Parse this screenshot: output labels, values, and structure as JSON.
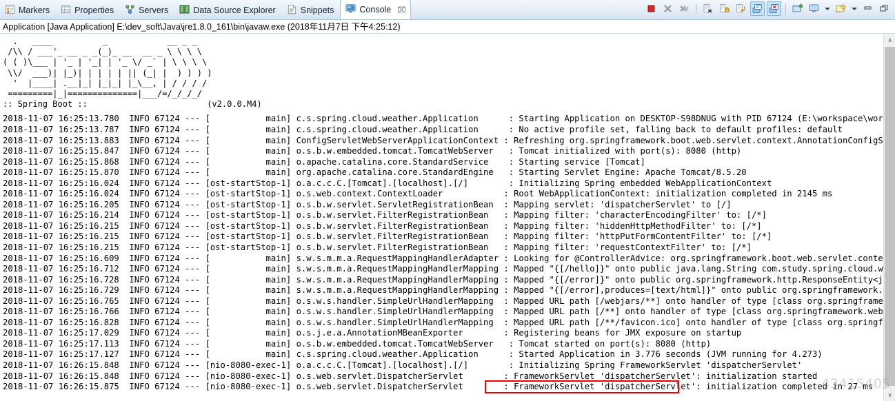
{
  "tabs": [
    {
      "label": "Markers",
      "icon": "markers-icon",
      "active": false
    },
    {
      "label": "Properties",
      "icon": "properties-icon",
      "active": false
    },
    {
      "label": "Servers",
      "icon": "servers-icon",
      "active": false
    },
    {
      "label": "Data Source Explorer",
      "icon": "datasource-icon",
      "active": false
    },
    {
      "label": "Snippets",
      "icon": "snippets-icon",
      "active": false
    },
    {
      "label": "Console",
      "icon": "console-icon",
      "active": true,
      "close_glyph": "⌧"
    }
  ],
  "toolbar": {
    "buttons": [
      {
        "name": "terminate-button",
        "title": "Terminate"
      },
      {
        "name": "remove-launch-button",
        "title": "Remove Launch"
      },
      {
        "name": "remove-all-terminated-button",
        "title": "Remove All Terminated Launches"
      },
      {
        "name": "clear-console-button",
        "title": "Clear Console"
      },
      {
        "name": "scroll-lock-button",
        "title": "Scroll Lock"
      },
      {
        "name": "word-wrap-button",
        "title": "Word Wrap"
      },
      {
        "name": "show-console-stdout-button",
        "title": "Show Console When Standard Out Changes",
        "pressed": true
      },
      {
        "name": "show-console-stderr-button",
        "title": "Show Console When Standard Error Changes",
        "pressed": true
      },
      {
        "name": "pin-console-button",
        "title": "Pin Console"
      },
      {
        "name": "display-selected-console-button",
        "title": "Display Selected Console"
      },
      {
        "name": "open-console-button",
        "title": "Open Console"
      },
      {
        "name": "minimize-button",
        "title": "Minimize"
      },
      {
        "name": "maximize-button",
        "title": "Maximize"
      }
    ]
  },
  "launch_config": {
    "text": "Application [Java Application] E:\\dev_soft\\Java\\jre1.8.0_161\\bin\\javaw.exe (2018年11月7日 下午4:25:12)"
  },
  "banner": {
    "ascii": "  .   ____          _            __ _ _\n /\\\\ / ___'_ __ _ _(_)_ __  __ _ \\ \\ \\ \\\n( ( )\\___ | '_ | '_| | '_ \\/ _` | \\ \\ \\ \\\n \\\\/  ___)| |_)| | | | | || (_| |  ) ) ) )\n  '  |____| .__|_| |_|_| |_\\__, | / / / /\n =========|_|==============|___/=/_/_/_/",
    "name": ":: Spring Boot ::",
    "version": "(v2.0.0.M4)"
  },
  "highlight": {
    "color": "#ee0000",
    "line_index": 25,
    "text": "Tomcat started on port(s): 8080 (http)"
  },
  "watermark": {
    "text": "43415405"
  },
  "scrollbar": {
    "up_glyph": "∧",
    "down_glyph": "∨"
  },
  "log_lines": [
    "2018-11-07 16:25:13.780  INFO 67124 --- [           main] c.s.spring.cloud.weather.Application      : Starting Application on DESKTOP-S98DNUG with PID 67124 (E:\\workspace\\workspace-st",
    "2018-11-07 16:25:13.787  INFO 67124 --- [           main] c.s.spring.cloud.weather.Application      : No active profile set, falling back to default profiles: default",
    "2018-11-07 16:25:13.883  INFO 67124 --- [           main] ConfigServletWebServerApplicationContext : Refreshing org.springframework.boot.web.servlet.context.AnnotationConfigServletWe",
    "2018-11-07 16:25:15.847  INFO 67124 --- [           main] o.s.b.w.embedded.tomcat.TomcatWebServer   : Tomcat initialized with port(s): 8080 (http)",
    "2018-11-07 16:25:15.868  INFO 67124 --- [           main] o.apache.catalina.core.StandardService    : Starting service [Tomcat]",
    "2018-11-07 16:25:15.870  INFO 67124 --- [           main] org.apache.catalina.core.StandardEngine   : Starting Servlet Engine: Apache Tomcat/8.5.20",
    "2018-11-07 16:25:16.024  INFO 67124 --- [ost-startStop-1] o.a.c.c.C.[Tomcat].[localhost].[/]        : Initializing Spring embedded WebApplicationContext",
    "2018-11-07 16:25:16.024  INFO 67124 --- [ost-startStop-1] o.s.web.context.ContextLoader            : Root WebApplicationContext: initialization completed in 2145 ms",
    "2018-11-07 16:25:16.205  INFO 67124 --- [ost-startStop-1] o.s.b.w.servlet.ServletRegistrationBean  : Mapping servlet: 'dispatcherServlet' to [/]",
    "2018-11-07 16:25:16.214  INFO 67124 --- [ost-startStop-1] o.s.b.w.servlet.FilterRegistrationBean   : Mapping filter: 'characterEncodingFilter' to: [/*]",
    "2018-11-07 16:25:16.215  INFO 67124 --- [ost-startStop-1] o.s.b.w.servlet.FilterRegistrationBean   : Mapping filter: 'hiddenHttpMethodFilter' to: [/*]",
    "2018-11-07 16:25:16.215  INFO 67124 --- [ost-startStop-1] o.s.b.w.servlet.FilterRegistrationBean   : Mapping filter: 'httpPutFormContentFilter' to: [/*]",
    "2018-11-07 16:25:16.215  INFO 67124 --- [ost-startStop-1] o.s.b.w.servlet.FilterRegistrationBean   : Mapping filter: 'requestContextFilter' to: [/*]",
    "2018-11-07 16:25:16.609  INFO 67124 --- [           main] s.w.s.m.m.a.RequestMappingHandlerAdapter : Looking for @ControllerAdvice: org.springframework.boot.web.servlet.context.Annot",
    "2018-11-07 16:25:16.712  INFO 67124 --- [           main] s.w.s.m.m.a.RequestMappingHandlerMapping : Mapped \"{[/hello]}\" onto public java.lang.String com.study.spring.cloud.weather.c",
    "2018-11-07 16:25:16.728  INFO 67124 --- [           main] s.w.s.m.m.a.RequestMappingHandlerMapping : Mapped \"{[/error]}\" onto public org.springframework.http.ResponseEntity<java.util",
    "2018-11-07 16:25:16.729  INFO 67124 --- [           main] s.w.s.m.m.a.RequestMappingHandlerMapping : Mapped \"{[/error],produces=[text/html]}\" onto public org.springframework.web.serv",
    "2018-11-07 16:25:16.765  INFO 67124 --- [           main] o.s.w.s.handler.SimpleUrlHandlerMapping  : Mapped URL path [/webjars/**] onto handler of type [class org.springframework.web",
    "2018-11-07 16:25:16.766  INFO 67124 --- [           main] o.s.w.s.handler.SimpleUrlHandlerMapping  : Mapped URL path [/**] onto handler of type [class org.springframework.web.servlet",
    "2018-11-07 16:25:16.828  INFO 67124 --- [           main] o.s.w.s.handler.SimpleUrlHandlerMapping  : Mapped URL path [/**/favicon.ico] onto handler of type [class org.springframework",
    "2018-11-07 16:25:17.029  INFO 67124 --- [           main] o.s.j.e.a.AnnotationMBeanExporter        : Registering beans for JMX exposure on startup",
    "2018-11-07 16:25:17.113  INFO 67124 --- [           main] o.s.b.w.embedded.tomcat.TomcatWebServer   : Tomcat started on port(s): 8080 (http)",
    "2018-11-07 16:25:17.127  INFO 67124 --- [           main] c.s.spring.cloud.weather.Application      : Started Application in 3.776 seconds (JVM running for 4.273)",
    "2018-11-07 16:26:15.848  INFO 67124 --- [nio-8080-exec-1] o.a.c.c.C.[Tomcat].[localhost].[/]        : Initializing Spring FrameworkServlet 'dispatcherServlet'",
    "2018-11-07 16:26:15.848  INFO 67124 --- [nio-8080-exec-1] o.s.web.servlet.DispatcherServlet        : FrameworkServlet 'dispatcherServlet': initialization started",
    "2018-11-07 16:26:15.875  INFO 67124 --- [nio-8080-exec-1] o.s.web.servlet.DispatcherServlet        : FrameworkServlet 'dispatcherServlet': initialization completed in 27 ms"
  ]
}
